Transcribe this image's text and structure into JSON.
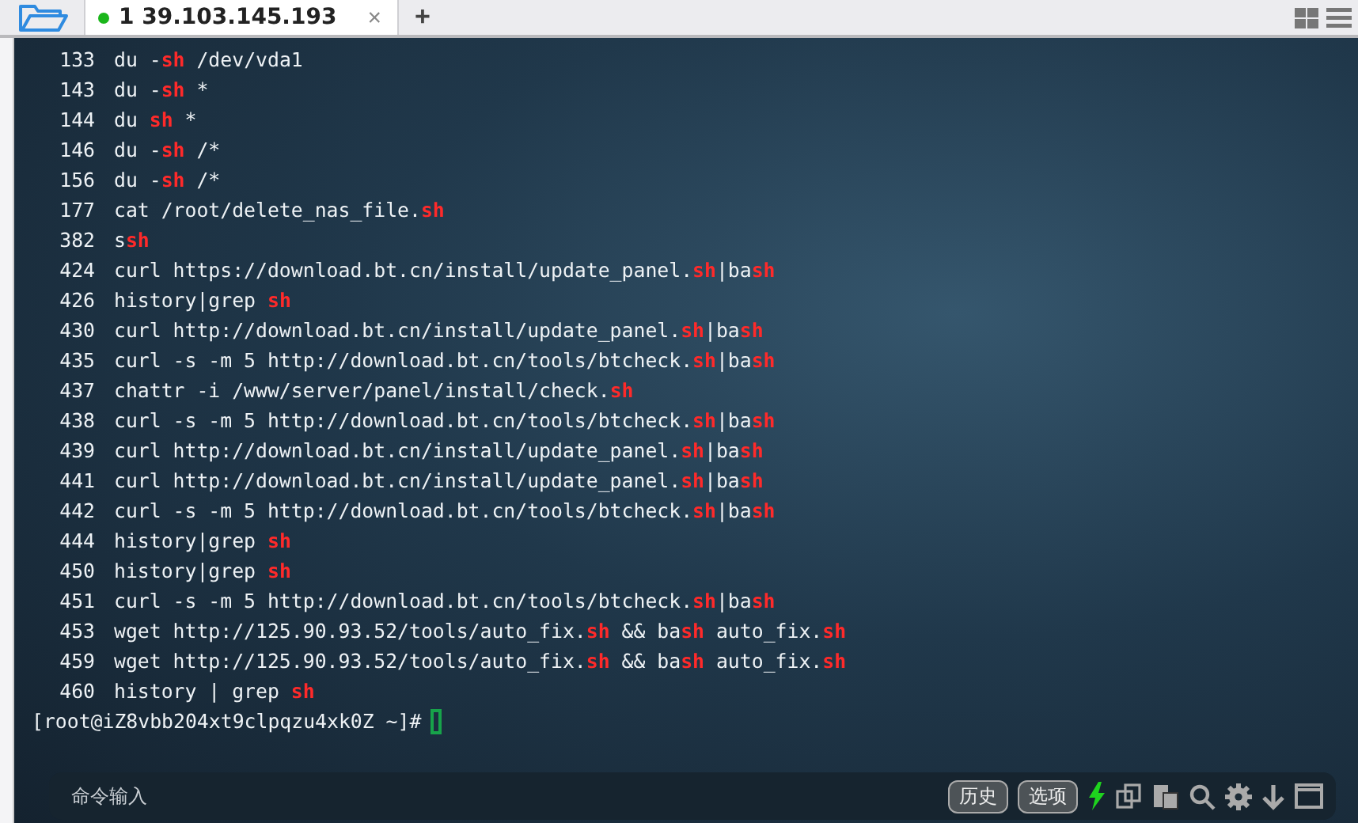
{
  "tabs": [
    {
      "label": "1 39.103.145.193",
      "selected": true,
      "connected": true,
      "close": "×"
    }
  ],
  "new_tab": "+",
  "lines": [
    {
      "num": "133",
      "segments": [
        {
          "text": "du -",
          "hl": false
        },
        {
          "text": "sh",
          "hl": true
        },
        {
          "text": " /dev/vda1",
          "hl": false
        }
      ]
    },
    {
      "num": "143",
      "segments": [
        {
          "text": "du -",
          "hl": false
        },
        {
          "text": "sh",
          "hl": true
        },
        {
          "text": " *",
          "hl": false
        }
      ]
    },
    {
      "num": "144",
      "segments": [
        {
          "text": "du ",
          "hl": false
        },
        {
          "text": "sh",
          "hl": true
        },
        {
          "text": " *",
          "hl": false
        }
      ]
    },
    {
      "num": "146",
      "segments": [
        {
          "text": "du -",
          "hl": false
        },
        {
          "text": "sh",
          "hl": true
        },
        {
          "text": " /*",
          "hl": false
        }
      ]
    },
    {
      "num": "156",
      "segments": [
        {
          "text": "du -",
          "hl": false
        },
        {
          "text": "sh",
          "hl": true
        },
        {
          "text": " /*",
          "hl": false
        }
      ]
    },
    {
      "num": "177",
      "segments": [
        {
          "text": "cat /root/delete_nas_file.",
          "hl": false
        },
        {
          "text": "sh",
          "hl": true
        }
      ]
    },
    {
      "num": "382",
      "segments": [
        {
          "text": "s",
          "hl": false
        },
        {
          "text": "sh",
          "hl": true
        }
      ]
    },
    {
      "num": "424",
      "segments": [
        {
          "text": "curl https://download.bt.cn/install/update_panel.",
          "hl": false
        },
        {
          "text": "sh",
          "hl": true
        },
        {
          "text": "|ba",
          "hl": false
        },
        {
          "text": "sh",
          "hl": true
        }
      ]
    },
    {
      "num": "426",
      "segments": [
        {
          "text": "history|grep ",
          "hl": false
        },
        {
          "text": "sh",
          "hl": true
        }
      ]
    },
    {
      "num": "430",
      "segments": [
        {
          "text": "curl http://download.bt.cn/install/update_panel.",
          "hl": false
        },
        {
          "text": "sh",
          "hl": true
        },
        {
          "text": "|ba",
          "hl": false
        },
        {
          "text": "sh",
          "hl": true
        }
      ]
    },
    {
      "num": "435",
      "segments": [
        {
          "text": "curl -s -m 5 http://download.bt.cn/tools/btcheck.",
          "hl": false
        },
        {
          "text": "sh",
          "hl": true
        },
        {
          "text": "|ba",
          "hl": false
        },
        {
          "text": "sh",
          "hl": true
        }
      ]
    },
    {
      "num": "437",
      "segments": [
        {
          "text": "chattr -i /www/server/panel/install/check.",
          "hl": false
        },
        {
          "text": "sh",
          "hl": true
        }
      ]
    },
    {
      "num": "438",
      "segments": [
        {
          "text": "curl -s -m 5 http://download.bt.cn/tools/btcheck.",
          "hl": false
        },
        {
          "text": "sh",
          "hl": true
        },
        {
          "text": "|ba",
          "hl": false
        },
        {
          "text": "sh",
          "hl": true
        }
      ]
    },
    {
      "num": "439",
      "segments": [
        {
          "text": "curl http://download.bt.cn/install/update_panel.",
          "hl": false
        },
        {
          "text": "sh",
          "hl": true
        },
        {
          "text": "|ba",
          "hl": false
        },
        {
          "text": "sh",
          "hl": true
        }
      ]
    },
    {
      "num": "441",
      "segments": [
        {
          "text": "curl http://download.bt.cn/install/update_panel.",
          "hl": false
        },
        {
          "text": "sh",
          "hl": true
        },
        {
          "text": "|ba",
          "hl": false
        },
        {
          "text": "sh",
          "hl": true
        }
      ]
    },
    {
      "num": "442",
      "segments": [
        {
          "text": "curl -s -m 5 http://download.bt.cn/tools/btcheck.",
          "hl": false
        },
        {
          "text": "sh",
          "hl": true
        },
        {
          "text": "|ba",
          "hl": false
        },
        {
          "text": "sh",
          "hl": true
        }
      ]
    },
    {
      "num": "444",
      "segments": [
        {
          "text": "history|grep ",
          "hl": false
        },
        {
          "text": "sh",
          "hl": true
        }
      ]
    },
    {
      "num": "450",
      "segments": [
        {
          "text": "history|grep ",
          "hl": false
        },
        {
          "text": "sh",
          "hl": true
        }
      ]
    },
    {
      "num": "451",
      "segments": [
        {
          "text": "curl -s -m 5 http://download.bt.cn/tools/btcheck.",
          "hl": false
        },
        {
          "text": "sh",
          "hl": true
        },
        {
          "text": "|ba",
          "hl": false
        },
        {
          "text": "sh",
          "hl": true
        }
      ]
    },
    {
      "num": "453",
      "segments": [
        {
          "text": "wget http://125.90.93.52/tools/auto_fix.",
          "hl": false
        },
        {
          "text": "sh",
          "hl": true
        },
        {
          "text": " && ba",
          "hl": false
        },
        {
          "text": "sh",
          "hl": true
        },
        {
          "text": " auto_fix.",
          "hl": false
        },
        {
          "text": "sh",
          "hl": true
        }
      ]
    },
    {
      "num": "459",
      "segments": [
        {
          "text": "wget http://125.90.93.52/tools/auto_fix.",
          "hl": false
        },
        {
          "text": "sh",
          "hl": true
        },
        {
          "text": " && ba",
          "hl": false
        },
        {
          "text": "sh",
          "hl": true
        },
        {
          "text": " auto_fix.",
          "hl": false
        },
        {
          "text": "sh",
          "hl": true
        }
      ]
    },
    {
      "num": "460",
      "segments": [
        {
          "text": "history | grep ",
          "hl": false
        },
        {
          "text": "sh",
          "hl": true
        }
      ]
    }
  ],
  "prompt": "[root@iZ8vbb204xt9clpqzu4xk0Z ~]#",
  "command_input": {
    "placeholder": "命令输入"
  },
  "buttons": [
    "历史",
    "选项"
  ]
}
